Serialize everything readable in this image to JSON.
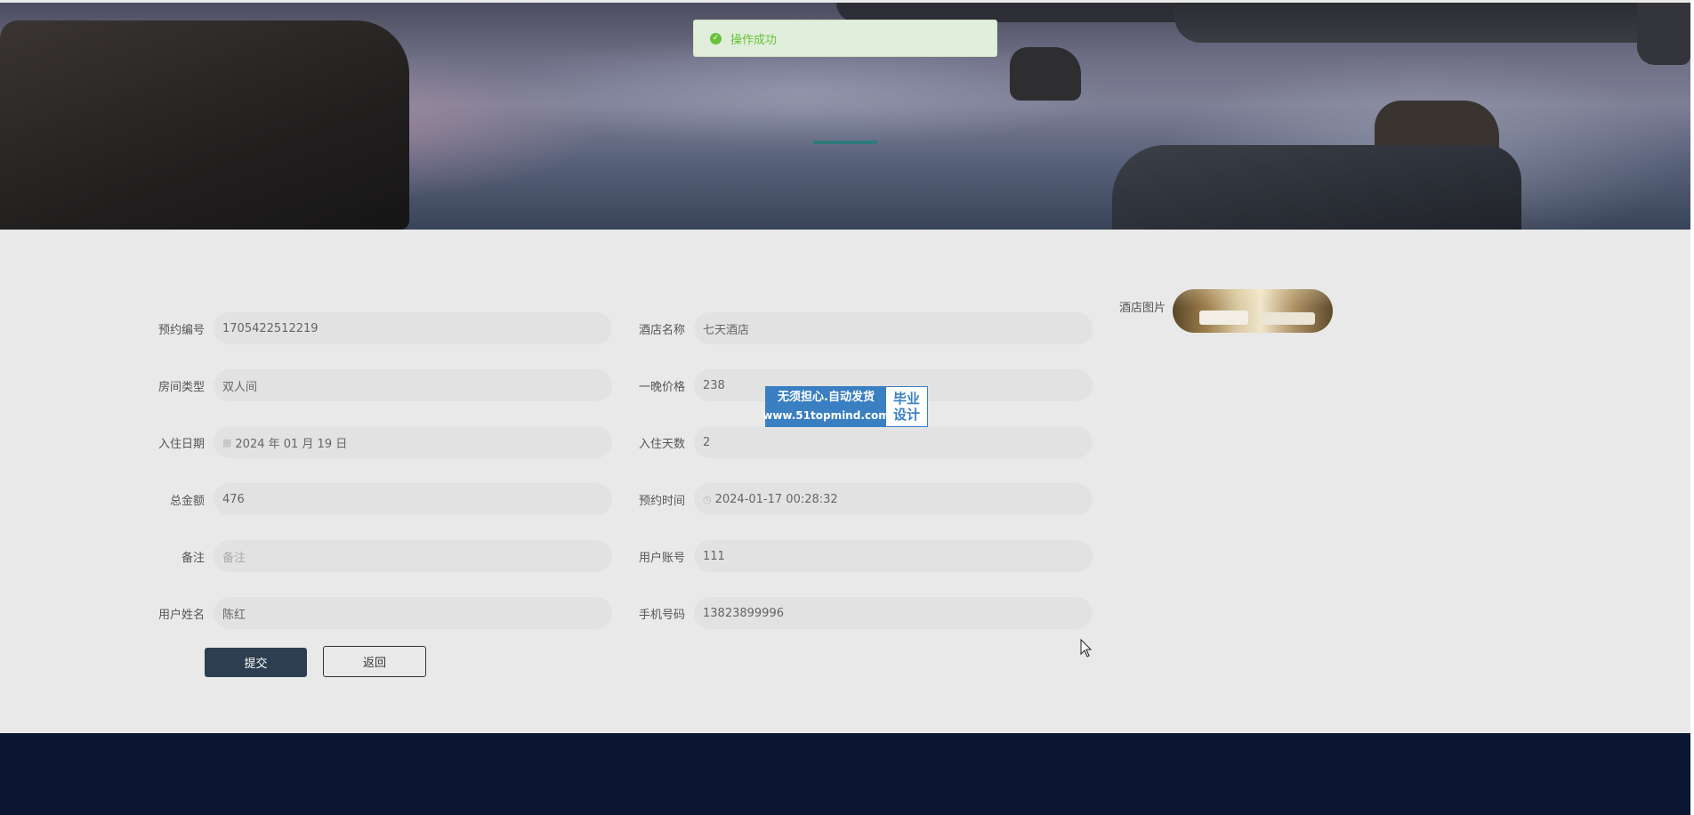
{
  "toast": {
    "message": "操作成功",
    "icon": "check-circle-icon",
    "color": "#67c23a"
  },
  "form": {
    "fields": [
      {
        "label": "预约编号",
        "value": "1705422512219"
      },
      {
        "label": "酒店名称",
        "value": "七天酒店"
      },
      {
        "label": "房间类型",
        "value": "双人间"
      },
      {
        "label": "一晚价格",
        "value": "238"
      },
      {
        "label": "入住日期",
        "value": "2024 年 01 月 19 日",
        "icon": "calendar-icon"
      },
      {
        "label": "入住天数",
        "value": "2"
      },
      {
        "label": "总金额",
        "value": "476"
      },
      {
        "label": "预约时间",
        "value": "2024-01-17 00:28:32",
        "icon": "clock-icon"
      },
      {
        "label": "备注",
        "placeholder": "备注"
      },
      {
        "label": "用户账号",
        "value": "111"
      },
      {
        "label": "用户姓名",
        "value": "陈红"
      },
      {
        "label": "手机号码",
        "value": "13823899996"
      }
    ],
    "image_label": "酒店图片"
  },
  "buttons": {
    "submit": "提交",
    "back": "返回"
  },
  "watermark": {
    "line1": "无须担心.自动发货",
    "line2": "www.51topmind.com",
    "right1": "毕业",
    "right2": "设计"
  },
  "colors": {
    "footer": "#0d1733",
    "submit_button": "#2c3e50",
    "indicator": "#2f7a7c"
  }
}
